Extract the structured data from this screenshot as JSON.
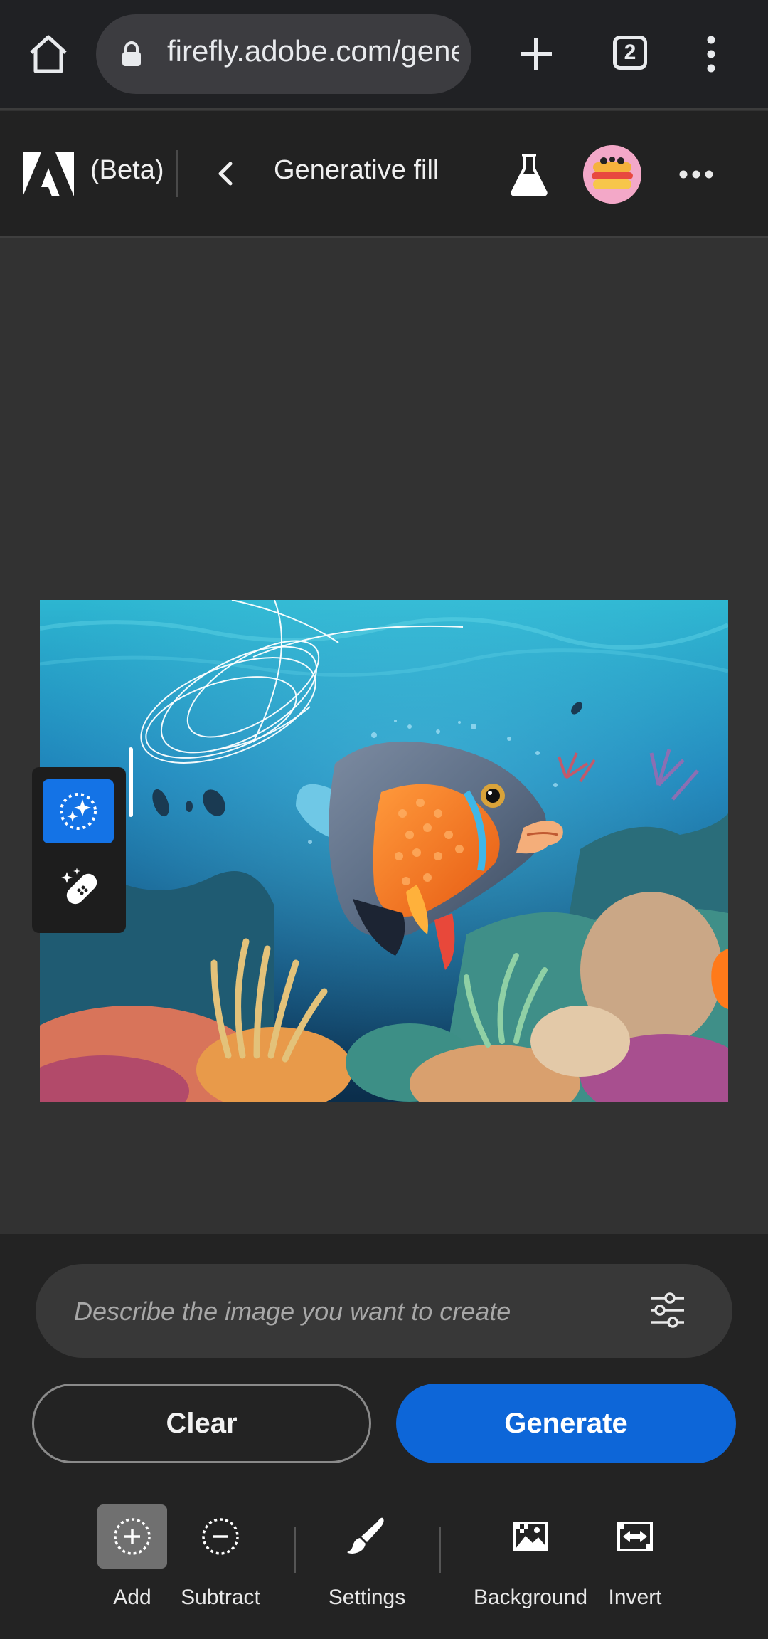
{
  "browser": {
    "url": "firefly.adobe.com/generative-fill",
    "tab_count": "2"
  },
  "header": {
    "beta_label": "(Beta)",
    "title": "Generative fill"
  },
  "prompt": {
    "placeholder": "Describe the image you want to create",
    "value": ""
  },
  "actions": {
    "clear_label": "Clear",
    "generate_label": "Generate"
  },
  "toolbar": {
    "add_label": "Add",
    "subtract_label": "Subtract",
    "settings_label": "Settings",
    "background_label": "Background",
    "invert_label": "Invert"
  },
  "colors": {
    "accent": "#0d66d8",
    "tool_active": "#1473e6",
    "background": "#323232"
  }
}
